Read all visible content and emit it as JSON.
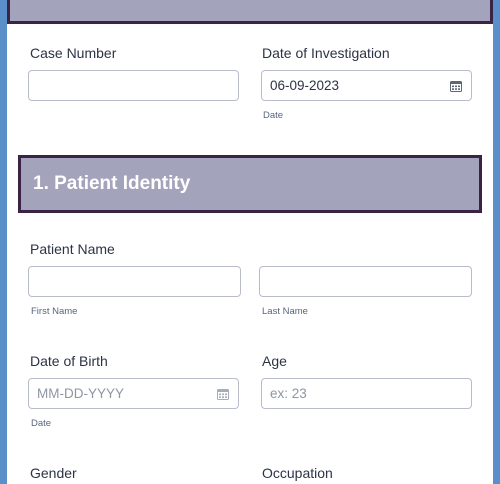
{
  "case": {
    "label": "Case Number",
    "value": ""
  },
  "investigation": {
    "label": "Date of Investigation",
    "value": "06-09-2023",
    "sublabel": "Date"
  },
  "section1": {
    "title": "1. Patient Identity"
  },
  "patient_name": {
    "label": "Patient Name",
    "first_sublabel": "First Name",
    "last_sublabel": "Last Name"
  },
  "dob": {
    "label": "Date of Birth",
    "placeholder": "MM-DD-YYYY",
    "sublabel": "Date"
  },
  "age": {
    "label": "Age",
    "placeholder": "ex: 23"
  },
  "gender": {
    "label": "Gender"
  },
  "occupation": {
    "label": "Occupation"
  },
  "colors": {
    "background": "#5b8fc9",
    "header_fill": "#a3a3bb",
    "header_border": "#3a2344"
  }
}
